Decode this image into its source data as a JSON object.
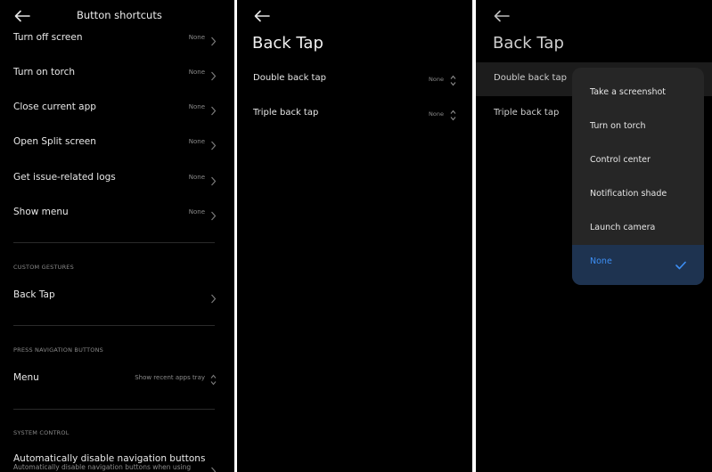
{
  "panel1": {
    "title": "Button shortcuts",
    "rows": [
      {
        "label": "Turn off screen",
        "value": "None"
      },
      {
        "label": "Turn on torch",
        "value": "None"
      },
      {
        "label": "Close current app",
        "value": "None"
      },
      {
        "label": "Open Split screen",
        "value": "None"
      },
      {
        "label": "Get issue-related logs",
        "value": "None"
      },
      {
        "label": "Show menu",
        "value": "None"
      }
    ],
    "custom_gestures": {
      "heading": "CUSTOM GESTURES",
      "back_tap_label": "Back Tap"
    },
    "press_navigation": {
      "heading": "PRESS NAVIGATION BUTTONS",
      "menu_label": "Menu",
      "menu_value": "Show recent apps tray"
    },
    "system_control": {
      "heading": "SYSTEM CONTROL",
      "auto_disable_label": "Automatically disable navigation buttons",
      "auto_disable_sub": "Automatically disable navigation buttons when using"
    }
  },
  "panel2": {
    "title": "Back Tap",
    "rows": [
      {
        "label": "Double back tap",
        "value": "None"
      },
      {
        "label": "Triple back tap",
        "value": "None"
      }
    ]
  },
  "panel3": {
    "title": "Back Tap",
    "rows": [
      {
        "label": "Double back tap"
      },
      {
        "label": "Triple back tap"
      }
    ],
    "dropdown": {
      "options": [
        "Take a screenshot",
        "Turn on torch",
        "Control center",
        "Notification shade",
        "Launch camera",
        "None"
      ],
      "selected": "None"
    }
  },
  "colors": {
    "background": "#000000",
    "dropdown_bg": "#262626",
    "selected_bg": "#1e3350",
    "accent": "#3d8ff5",
    "secondary_text": "#8a8a8a"
  },
  "icons": [
    "back-arrow-icon",
    "chevron-right-icon",
    "up-down-chevron-icon",
    "checkmark-icon"
  ]
}
